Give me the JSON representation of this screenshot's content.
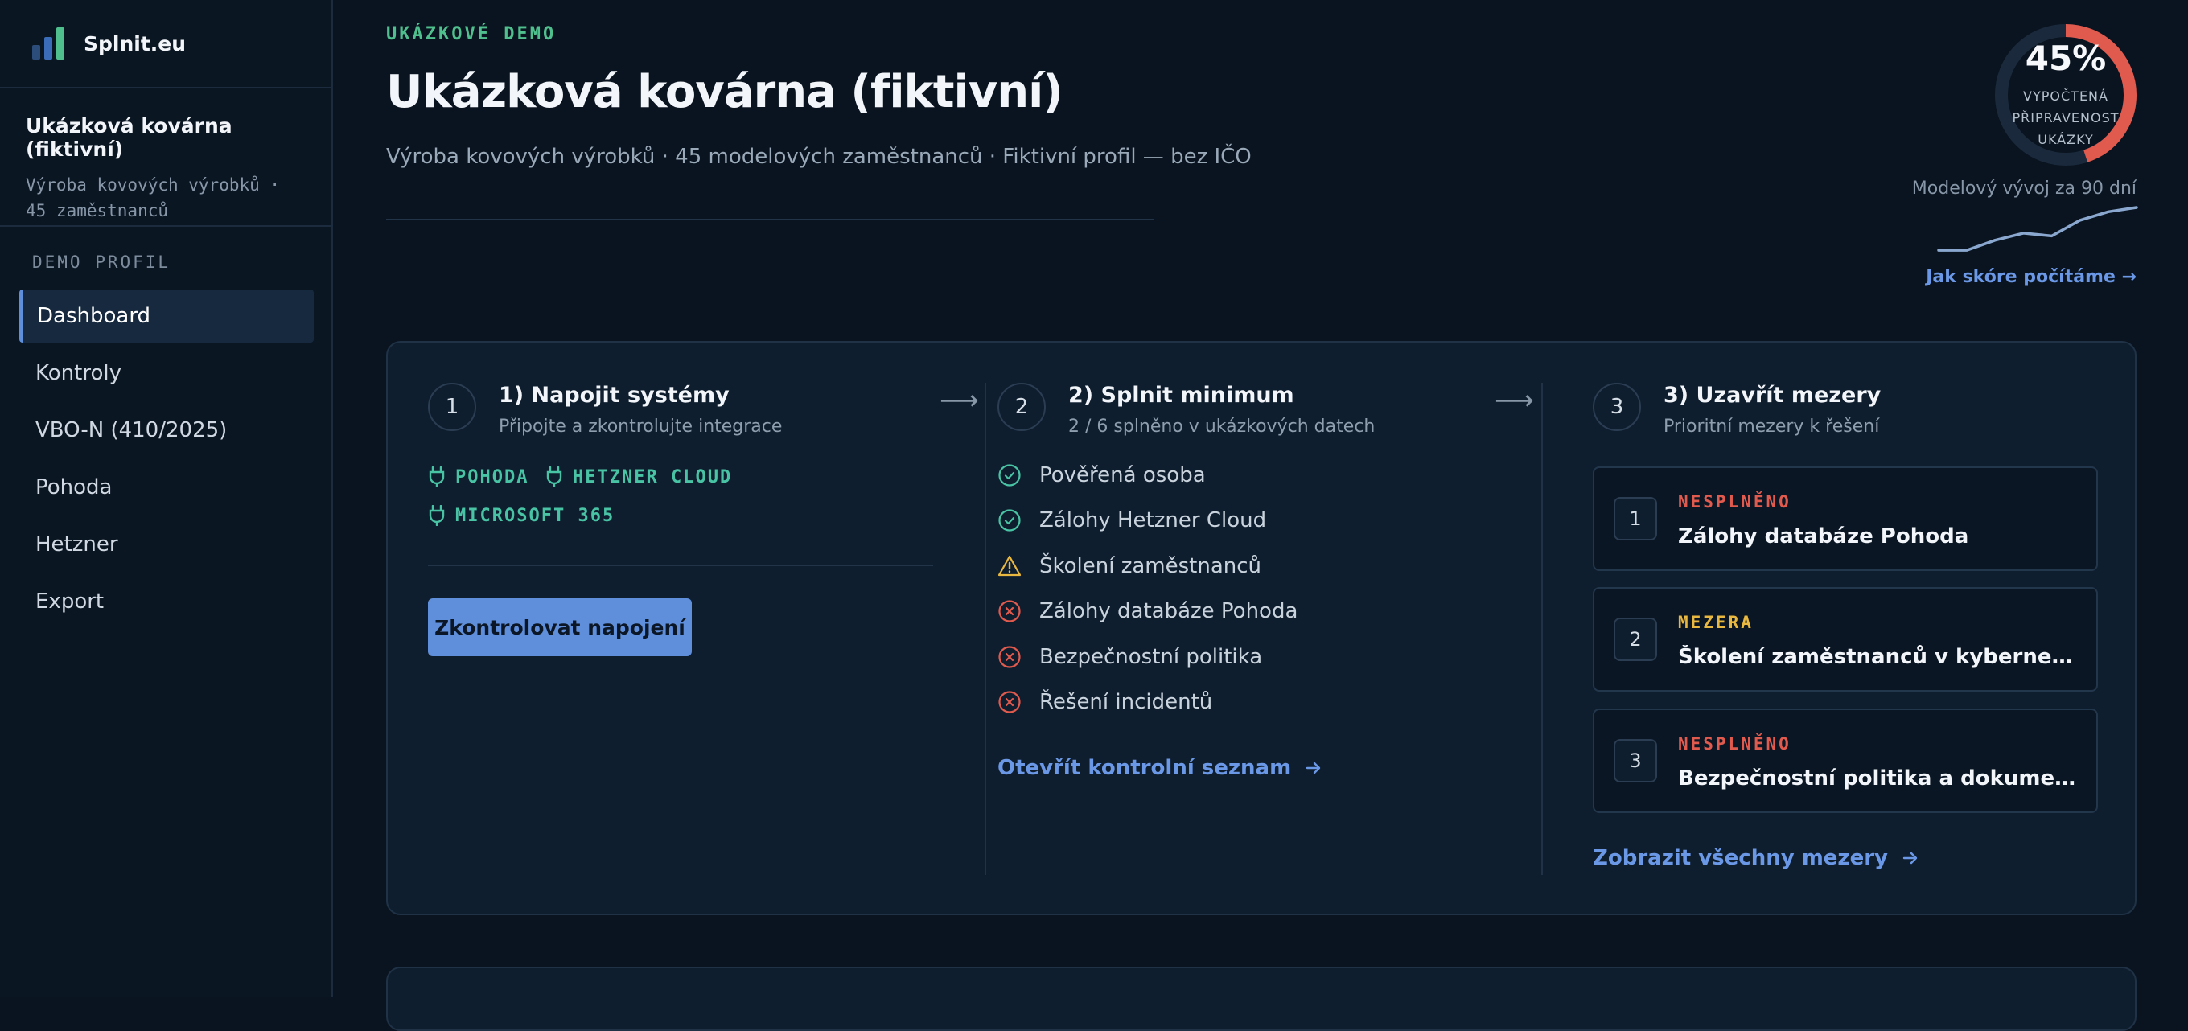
{
  "app": {
    "name": "Splnit.eu"
  },
  "colors": {
    "accent": "#5f8fda",
    "success": "#4fc08d",
    "teal": "#48c3a4",
    "warning": "#e8b840",
    "danger": "#e05a4e"
  },
  "sidebar": {
    "org_title": "Ukázková kovárna (fiktivní)",
    "org_sub_line1": "Výroba kovových výrobků ·",
    "org_sub_line2": "45 zaměstnanců",
    "section_label": "DEMO PROFIL",
    "items": [
      {
        "label": "Dashboard",
        "active": true
      },
      {
        "label": "Kontroly"
      },
      {
        "label": "VBO-N (410/2025)"
      },
      {
        "label": "Pohoda"
      },
      {
        "label": "Hetzner"
      },
      {
        "label": "Export"
      }
    ]
  },
  "header": {
    "eyebrow": "UKÁZKOVÉ DEMO",
    "title": "Ukázková kovárna (fiktivní)",
    "subtitle": "Výroba kovových výrobků · 45 modelových zaměstnanců · Fiktivní profil — bez IČO"
  },
  "score": {
    "percent_label": "45%",
    "value": 0.45,
    "label_line1": "VYPOČTENÁ",
    "label_line2": "PŘIPRAVENOST",
    "label_line3": "UKÁZKY",
    "trend_label": "Modelový vývoj za 90 dní",
    "trend_values": [
      5,
      5,
      12,
      17,
      15,
      26,
      32,
      35
    ],
    "link": "Jak skóre počítáme →"
  },
  "steps": [
    {
      "number": "1",
      "title": "1) Napojit systémy",
      "subtitle": "Připojte a zkontrolujte integrace",
      "integrations": [
        "POHODA",
        "HETZNER CLOUD",
        "MICROSOFT 365"
      ],
      "button": "Zkontrolovat napojení"
    },
    {
      "number": "2",
      "title": "2) Splnit minimum",
      "subtitle": "2 / 6 splněno v ukázkových datech",
      "items": [
        {
          "label": "Pověřená osoba",
          "status": "ok"
        },
        {
          "label": "Zálohy Hetzner Cloud",
          "status": "ok"
        },
        {
          "label": "Školení zaměstnanců",
          "status": "warn"
        },
        {
          "label": "Zálohy databáze Pohoda",
          "status": "fail"
        },
        {
          "label": "Bezpečnostní politika",
          "status": "fail"
        },
        {
          "label": "Řešení incidentů",
          "status": "fail"
        }
      ],
      "link": "Otevřít kontrolní seznam"
    },
    {
      "number": "3",
      "title": "3) Uzavřít mezery",
      "subtitle": "Prioritní mezery k řešení",
      "gaps": [
        {
          "number": "1",
          "status": "NESPLNĚNO",
          "title": "Zálohy databáze Pohoda"
        },
        {
          "number": "2",
          "status": "MEZERA",
          "title": "Školení zaměstnanců v kybernetické bezpečnosti"
        },
        {
          "number": "3",
          "status": "NESPLNĚNO",
          "title": "Bezpečnostní politika a dokumentace"
        }
      ],
      "link": "Zobrazit všechny mezery"
    }
  ]
}
